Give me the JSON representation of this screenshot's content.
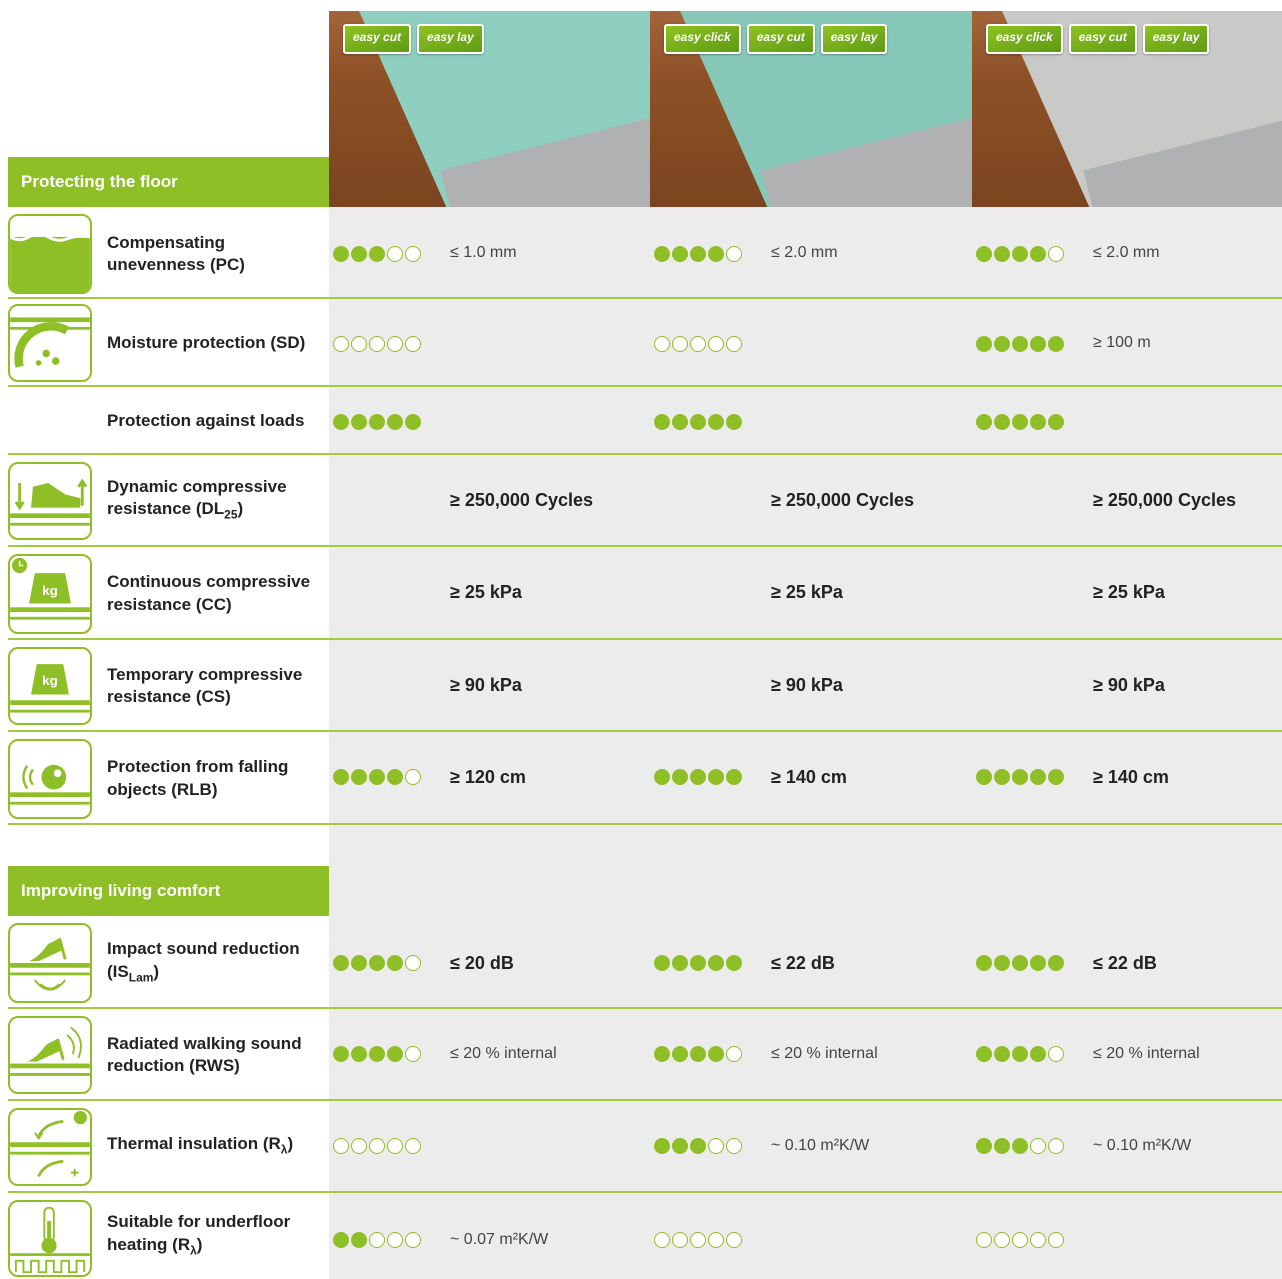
{
  "products": [
    {
      "badges": [
        "easy cut",
        "easy lay"
      ],
      "mat_color": "#8fcfc0"
    },
    {
      "badges": [
        "easy click",
        "easy cut",
        "easy lay"
      ],
      "mat_color": "#86c8b8"
    },
    {
      "badges": [
        "easy click",
        "easy cut",
        "easy lay"
      ],
      "mat_color": "#c9cac8"
    }
  ],
  "sections": {
    "floor": "Protecting the floor",
    "comfort": "Improving living comfort"
  },
  "rows": {
    "pc": {
      "label": "Compensating unevenness (PC)",
      "icon": "unevenness-icon",
      "ratings": [
        3,
        4,
        4
      ],
      "values": [
        "≤ 1.0 mm",
        "≤ 2.0 mm",
        "≤ 2.0 mm"
      ]
    },
    "sd": {
      "label": "Moisture protection (SD)",
      "icon": "moisture-icon",
      "ratings": [
        0,
        0,
        5
      ],
      "values": [
        "",
        "",
        "≥ 100 m"
      ]
    },
    "pal": {
      "label": "Protection against loads",
      "ratings": [
        5,
        5,
        5
      ],
      "values": [
        "",
        "",
        ""
      ]
    },
    "dl": {
      "label": "Dynamic compressive resistance (DL",
      "sub": "25",
      "tail": ")",
      "icon": "shoe-load-icon",
      "values": [
        "≥ 250,000 Cycles",
        "≥ 250,000 Cycles",
        "≥ 250,000 Cycles"
      ]
    },
    "cc": {
      "label": "Continuous compressive resistance (CC)",
      "icon": "weight-clock-icon",
      "icon_text": "kg",
      "values": [
        "≥ 25 kPa",
        "≥ 25 kPa",
        "≥ 25 kPa"
      ]
    },
    "cs": {
      "label": "Temporary compressive resistance (CS)",
      "icon": "weight-icon",
      "icon_text": "kg",
      "values": [
        "≥ 90 kPa",
        "≥ 90 kPa",
        "≥ 90 kPa"
      ]
    },
    "rlb": {
      "label": "Protection from falling objects (RLB)",
      "icon": "falling-ball-icon",
      "ratings": [
        4,
        5,
        5
      ],
      "values": [
        "≥ 120 cm",
        "≥ 140 cm",
        "≥ 140 cm"
      ]
    },
    "is": {
      "label": "Impact sound reduction (IS",
      "sub": "Lam",
      "tail": ")",
      "icon": "heel-impact-icon",
      "ratings": [
        4,
        5,
        5
      ],
      "values": [
        "≤ 20 dB",
        "≤ 22 dB",
        "≤ 22 dB"
      ]
    },
    "rws": {
      "label": "Radiated walking sound reduction (RWS)",
      "icon": "heel-sound-icon",
      "ratings": [
        4,
        4,
        4
      ],
      "values": [
        "≤ 20 % internal",
        "≤ 20 % internal",
        "≤ 20 % internal"
      ]
    },
    "ti": {
      "label": "Thermal insulation (R",
      "sub": "λ",
      "tail": ")",
      "icon": "sun-frost-icon",
      "ratings": [
        0,
        3,
        3
      ],
      "values": [
        "",
        "~ 0.10 m²K/W",
        "~ 0.10 m²K/W"
      ]
    },
    "uh": {
      "label": "Suitable for underfloor heating (R",
      "sub": "λ",
      "tail": ")",
      "icon": "thermometer-icon",
      "ratings": [
        2,
        0,
        0
      ],
      "values": [
        "~ 0.07 m²K/W",
        "",
        ""
      ]
    }
  }
}
